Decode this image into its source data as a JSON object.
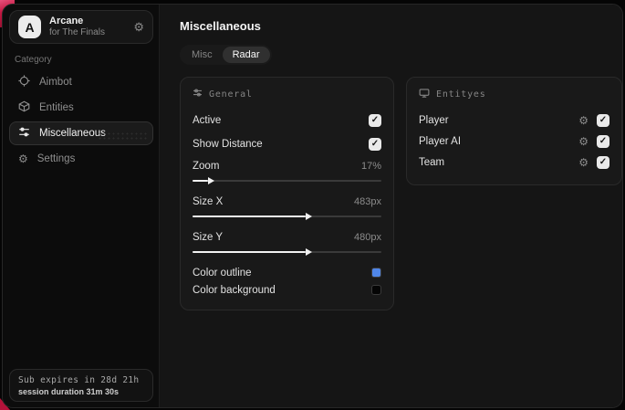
{
  "colors": {
    "accent_red": "#c21640",
    "checkbox_bg": "#e9e9e9",
    "outline_swatch": "#4f86e8",
    "background_swatch": "#050505"
  },
  "icons": {
    "gear": "⚙",
    "check": "✓"
  },
  "sidebar": {
    "brand": {
      "logo_letter": "A",
      "title": "Arcane",
      "subtitle": "for The Finals"
    },
    "category_label": "Category",
    "items": [
      {
        "label": "Aimbot",
        "icon": "crosshair-icon",
        "active": false
      },
      {
        "label": "Entities",
        "icon": "cube-icon",
        "active": false
      },
      {
        "label": "Miscellaneous",
        "icon": "sliders-icon",
        "active": true
      },
      {
        "label": "Settings",
        "icon": "gear-icon",
        "active": false
      }
    ],
    "footer": {
      "line1": "Sub expires in 28d 21h",
      "line2": "session duration 31m 30s"
    }
  },
  "main": {
    "title": "Miscellaneous",
    "tabs": [
      {
        "label": "Misc",
        "active": false
      },
      {
        "label": "Radar",
        "active": true
      }
    ],
    "panels": [
      {
        "title": "General",
        "icon": "sliders-icon",
        "rows": [
          {
            "type": "checkbox",
            "label": "Active",
            "checked": true
          },
          {
            "type": "checkbox",
            "label": "Show Distance",
            "checked": true
          },
          {
            "type": "slider",
            "label": "Zoom",
            "value": "17%",
            "fill_pct": 8
          },
          {
            "type": "slider",
            "label": "Size X",
            "value": "483px",
            "fill_pct": 60
          },
          {
            "type": "slider",
            "label": "Size Y",
            "value": "480px",
            "fill_pct": 60
          },
          {
            "type": "color",
            "label": "Color outline",
            "color": "#4f86e8"
          },
          {
            "type": "color",
            "label": "Color background",
            "color": "#050505"
          }
        ]
      },
      {
        "title": "Entityes",
        "icon": "monitor-icon",
        "rows": [
          {
            "type": "entity",
            "label": "Player",
            "checked": true
          },
          {
            "type": "entity",
            "label": "Player AI",
            "checked": true
          },
          {
            "type": "entity",
            "label": "Team",
            "checked": true
          }
        ]
      }
    ]
  }
}
